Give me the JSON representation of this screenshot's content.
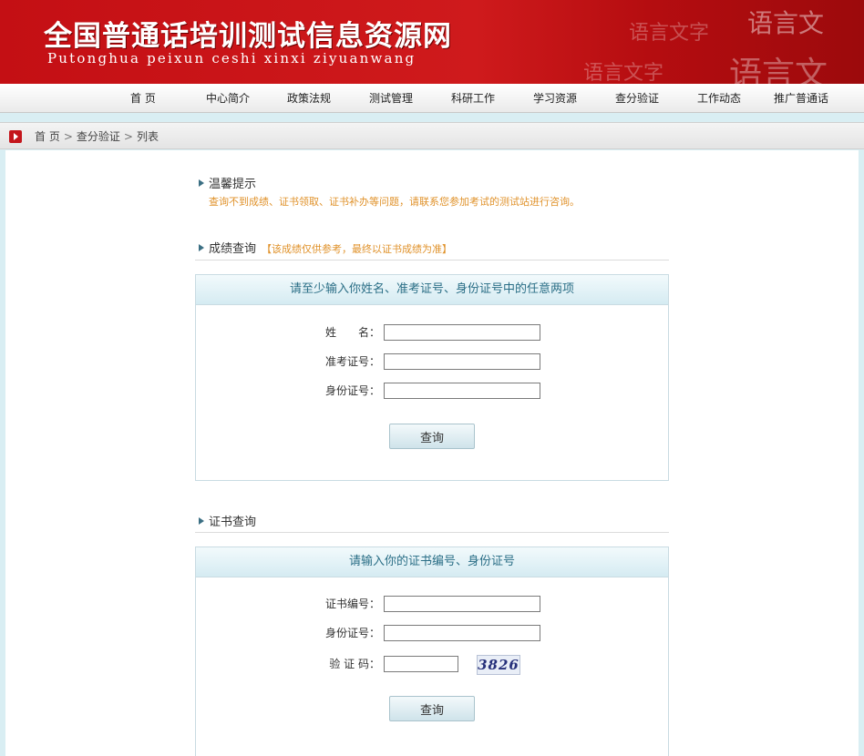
{
  "header": {
    "title": "全国普通话培训测试信息资源网",
    "subtitle": "Putonghua peixun ceshi xinxi ziyuanwang",
    "deco_texts": [
      "语言文字",
      "语言文",
      "语言文字",
      "语言文"
    ]
  },
  "nav": {
    "items": [
      "首 页",
      "中心简介",
      "政策法规",
      "测试管理",
      "科研工作",
      "学习资源",
      "查分验证",
      "工作动态",
      "推广普通话"
    ]
  },
  "breadcrumb": {
    "items": [
      "首 页",
      "查分验证",
      "列表"
    ],
    "separator": ">"
  },
  "tips": {
    "heading": "温馨提示",
    "text": "查询不到成绩、证书领取、证书补办等问题，请联系您参加考试的测试站进行咨询。"
  },
  "score_query": {
    "heading": "成绩查询",
    "note": "【该成绩仅供参考，最终以证书成绩为准】",
    "panel_title": "请至少输入你姓名、准考证号、身份证号中的任意两项",
    "fields": [
      {
        "label": "姓　　名：",
        "value": ""
      },
      {
        "label": "准考证号：",
        "value": ""
      },
      {
        "label": "身份证号：",
        "value": ""
      }
    ],
    "submit_label": "查询"
  },
  "cert_query": {
    "heading": "证书查询",
    "panel_title": "请输入你的证书编号、身份证号",
    "fields": [
      {
        "label": "证书编号：",
        "value": ""
      },
      {
        "label": "身份证号：",
        "value": ""
      },
      {
        "label": "验 证 码：",
        "value": ""
      }
    ],
    "captcha_text": "3826",
    "submit_label": "查询"
  },
  "colors": {
    "brand_red": "#c40f14",
    "accent_teal": "#2a6e86",
    "note_orange": "#e0922b"
  }
}
